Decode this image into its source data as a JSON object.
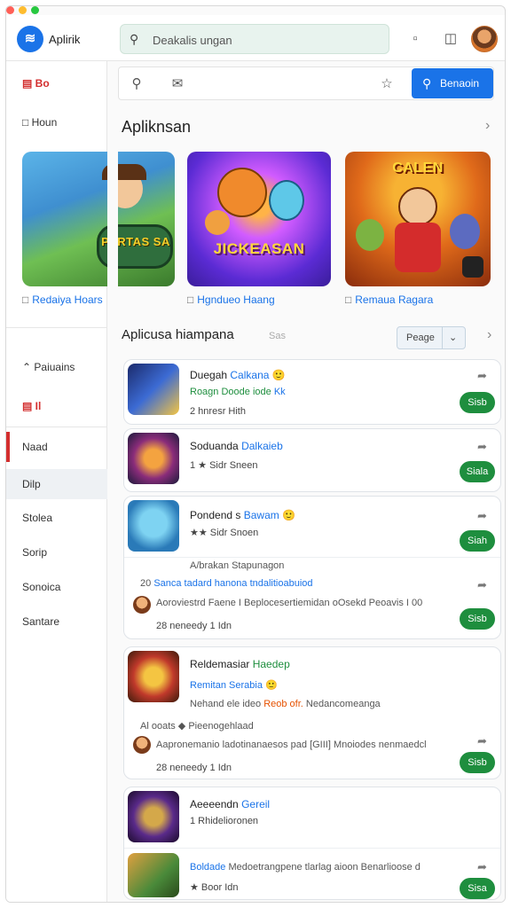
{
  "window": {
    "traffic_colors": [
      "#ff5f57",
      "#febc2e",
      "#28c840"
    ]
  },
  "topbar": {
    "app_name": "Aplirik",
    "logo_icon": "logo-icon",
    "search_placeholder": "Deakalis ungan",
    "icons": [
      "notifications-icon",
      "download-icon"
    ]
  },
  "sidebar": {
    "top_label": "Bo",
    "items": [
      {
        "label": "Houn",
        "icon": "home-icon"
      },
      {
        "label": "Paiuains",
        "icon": "caret-icon"
      },
      {
        "label": "Il",
        "icon": "library-icon"
      },
      {
        "label": "Naad"
      },
      {
        "label": "Dilp"
      },
      {
        "label": "Stolea"
      },
      {
        "label": "Sorip"
      },
      {
        "label": "Sonoica"
      },
      {
        "label": "Santare"
      }
    ]
  },
  "main": {
    "toolbar": {
      "button_label": "Benaoin",
      "icons": [
        "search-icon",
        "mail-icon",
        "star-icon"
      ]
    },
    "featured_title": "Apliknsan",
    "featured": [
      {
        "art_text": "PARTAS SA",
        "caption": "Redaiya Hoars"
      },
      {
        "art_text": "JICKEASAN",
        "caption": "Hgndueo Haang"
      },
      {
        "art_text": "CALEN",
        "caption": "Remaua Ragara"
      }
    ],
    "list_title": "Aplicusa hiampana",
    "list_hint": "Sas",
    "filter_label": "Peage",
    "apps": [
      {
        "title": "Duegah",
        "title_accent": "Calkana",
        "subtitle_green": "Roagn Doode iode",
        "subtitle_accent": "Kk",
        "meta": "2  hnresr  Hith",
        "button": "Sisb"
      },
      {
        "title": "Soduanda",
        "title_accent": "Dalkaieb",
        "meta": "1 ★ Sidr  Sneen",
        "button": "Siala"
      },
      {
        "title": "Pondend s",
        "title_accent": "Bawam",
        "meta": "★★ Sidr  Snoen",
        "button": "Siah",
        "note": "A/brakan Stapunagon",
        "subrow_prefix": "20",
        "subrow_accent": "Sanca tadard hanona",
        "subrow_accent2": "tndalitioabuiod",
        "comment": "Aoroviestrd Faene I Beplocesertiemidan oOsekd Peoavis I 00",
        "comment_meta": "28  neneedy  1 Idn",
        "comment_button": "Sisb"
      },
      {
        "title": "Reldemasiar",
        "title_accent": "Haedep",
        "subtitle_accent": "Remitan Serabia",
        "line3": "Nehand ele ideo",
        "line3_red": "Reob ofr.",
        "line3_tail": "Nedancomeanga",
        "note_prefix": "Al ooats",
        "note": "Pieenogehlaad",
        "comment": "Aapronemanio ladotinanaesos pad [GIII] Mnoiodes nenmaedcl",
        "comment_meta": "28  neneedy  1 Idn",
        "comment_button": "Sisb"
      },
      {
        "title": "Aeeeendn",
        "title_accent": "Gereil",
        "meta": "1 Rhidelioronen",
        "comment_accent": "Boldade",
        "comment": "Medoetrangpene  tlarlag aioon Benarlioose d",
        "comment_meta": "★ Boor  Idn",
        "comment_button": "Sisa"
      }
    ]
  },
  "colors": {
    "accent": "#1a73e8",
    "green": "#1e8e3e",
    "red": "#d32f2f"
  }
}
